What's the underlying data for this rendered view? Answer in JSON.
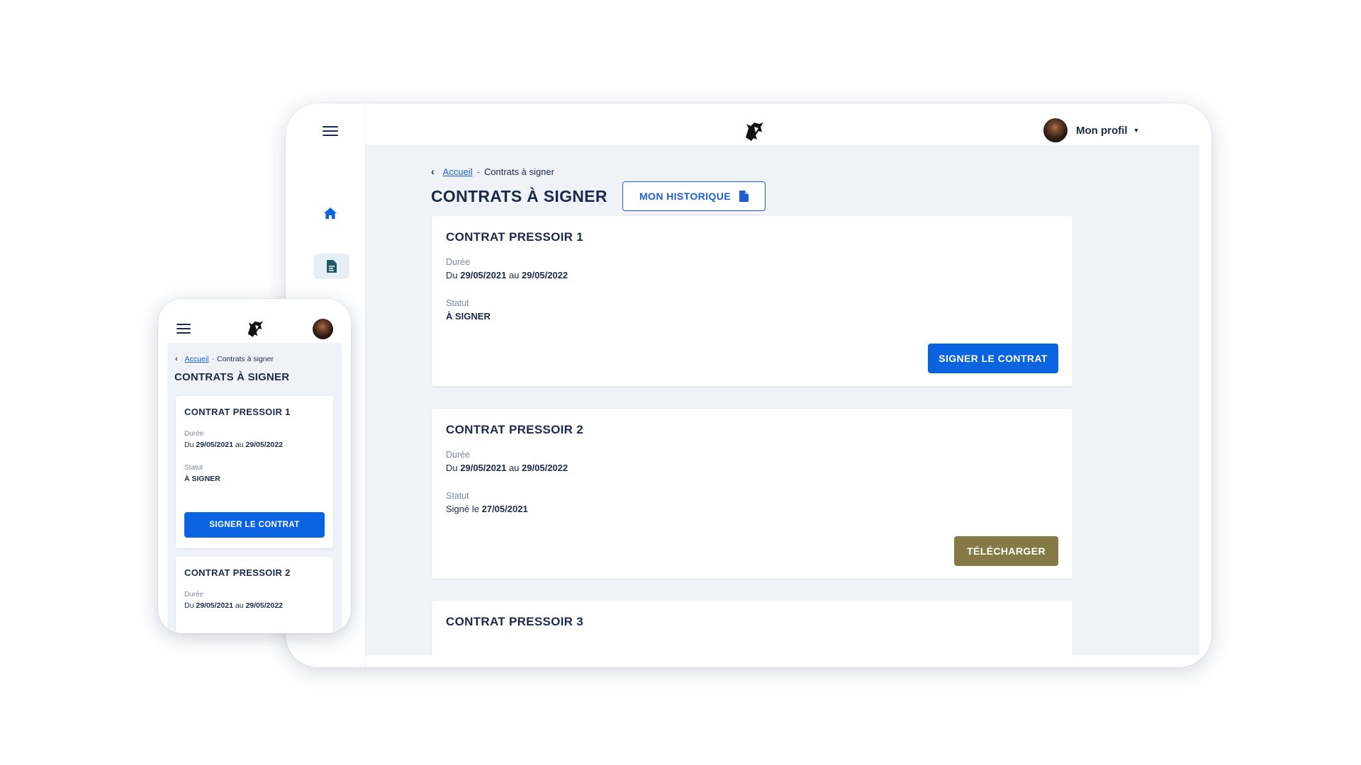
{
  "brand": {
    "primary": "#0a63e0",
    "download": "#857a45",
    "text": "#1b2a4a",
    "background": "#eff3f8"
  },
  "icons": {
    "menu": "hamburger-icon",
    "home": "home-icon",
    "documents": "document-icon",
    "logo": "horse-logo",
    "history": "file-icon"
  },
  "header": {
    "profile_label": "Mon profil"
  },
  "breadcrumb": {
    "home": "Accueil",
    "separator": "-",
    "current": "Contrats à signer"
  },
  "page": {
    "title": "CONTRATS À SIGNER",
    "history_button": "MON HISTORIQUE"
  },
  "labels": {
    "duration": "Durée",
    "status": "Statut",
    "from": "Du",
    "to": "au",
    "signed_on": "Signé le"
  },
  "contracts": [
    {
      "title": "CONTRAT PRESSOIR 1",
      "start": "29/05/2021",
      "end": "29/05/2022",
      "status": "À SIGNER",
      "action": "SIGNER LE CONTRAT"
    },
    {
      "title": "CONTRAT PRESSOIR 2",
      "start": "29/05/2021",
      "end": "29/05/2022",
      "signed_date": "27/05/2021",
      "action": "TÉLÉCHARGER"
    },
    {
      "title": "CONTRAT PRESSOIR 3"
    }
  ]
}
